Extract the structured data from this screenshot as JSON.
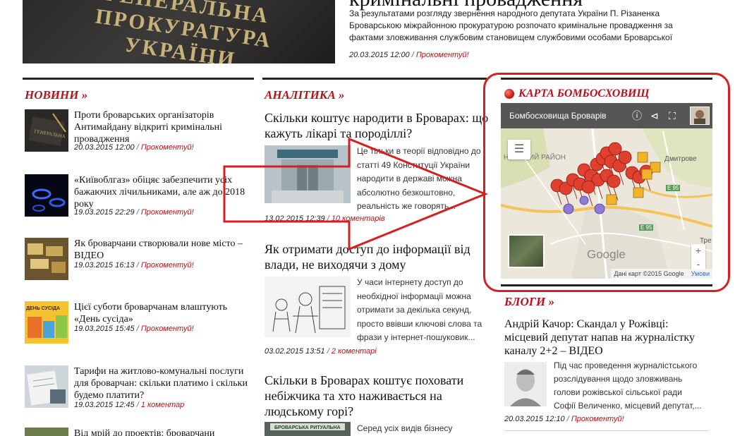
{
  "hero": {
    "title": "кримінальні провадження",
    "plate_text": "ГЕНЕРАЛЬНА ПРОКУРАТУРА УКРАЇНИ",
    "text": "За результатами розгляду звернення народного депутата України П. Різаненка Броварською міжрайонною прокуратурою розпочато кримінальне провадження за фактами зловживання службовим становищем службовими особами Броварської",
    "date": "20.03.2015 12:00",
    "comment": "Прокоментуй!"
  },
  "news": {
    "heading": "НОВИНИ »",
    "items": [
      {
        "title": "Проти броварських організаторів Антимайдану відкриті кримінальні провадження",
        "date": "20.03.2015 12:00",
        "comment": "Прокоментуй!"
      },
      {
        "title": "«Київоблгаз» обіцяє забезпечити усіх бажаючих лічильниками, але аж до 2018 року",
        "date": "19.03.2015 22:29",
        "comment": "Прокоментуй!"
      },
      {
        "title": "Як броварчани створювали нове місто – ВІДЕО",
        "date": "19.03.2015 16:13",
        "comment": "Прокоментуй!"
      },
      {
        "title": "Цієї суботи броварчанам влаштують «День сусіда»",
        "date": "19.03.2015 15:45",
        "comment": "Прокоментуй!",
        "thumb_label": "ДЕНЬ СУСІДА"
      },
      {
        "title": "Тарифи на житлово-комунальні послуги для броварчан: скільки платимо і скільки будемо платити?",
        "date": "19.03.2015 12:45",
        "comment": "1 коментар"
      },
      {
        "title": "Від мрій до проектів: броварчани"
      }
    ]
  },
  "analytics": {
    "heading": "АНАЛІТИКА »",
    "items": [
      {
        "title": "Скільки коштує народити в Броварах: що кажуть лікарі та породіллі?",
        "text": "Це тільки в теорії відповідно до статті 49 Конституції України народити в державі можна абсолютно безкоштовно, реальність же говорять...",
        "date": "13.02.2015 12:39",
        "comment": "10 коментарів"
      },
      {
        "title": "Як отримати доступ до інформації від влади, не виходячи з дому",
        "text": "У часи інтернету доступ до необхідної інформації можна отримати за декілька секунд, просто ввівши ключові слова та фрази у інтернет-пошуковик...",
        "date": "03.02.2015 13:51",
        "comment": "2 коментарі"
      },
      {
        "title": "Скільки в Броварах коштує поховати небіжчика та хто наживається на людському горі?",
        "text": "Серед усіх видів бізнесу",
        "thumb_label": "БРОВАРСЬКА РИТУАЛЬНА"
      }
    ]
  },
  "map_widget": {
    "heading": "КАРТА БОМБОСХОВИЩ",
    "map_title": "Бомбосховища Броварів",
    "places": {
      "district": "НІВСЬКИЙ РАЙОН",
      "town1": "Дмитрове",
      "town2": "Тре"
    },
    "roads": [
      "Е 95",
      "Е 95"
    ],
    "google": "Google",
    "attribution": "Дані карт ©2015 Google",
    "terms": "Умови",
    "zoom_in": "+",
    "zoom_out": "-"
  },
  "blogs": {
    "heading": "БЛОГИ »",
    "title": "Андрій Качор: Скандал у Рожівці: місцевий депутат напав на журналістку каналу 2+2 – ВІДЕО",
    "text": "Під час проведення журналістського розслідування щодо зловживань голови рожівської сільської ради Софії Величенко, місцевий депутат,...",
    "date": "20.03.2015 12:10",
    "comment": "Прокоментуй!"
  },
  "colors": {
    "accent": "#b5121b",
    "annotation": "#d42020"
  }
}
